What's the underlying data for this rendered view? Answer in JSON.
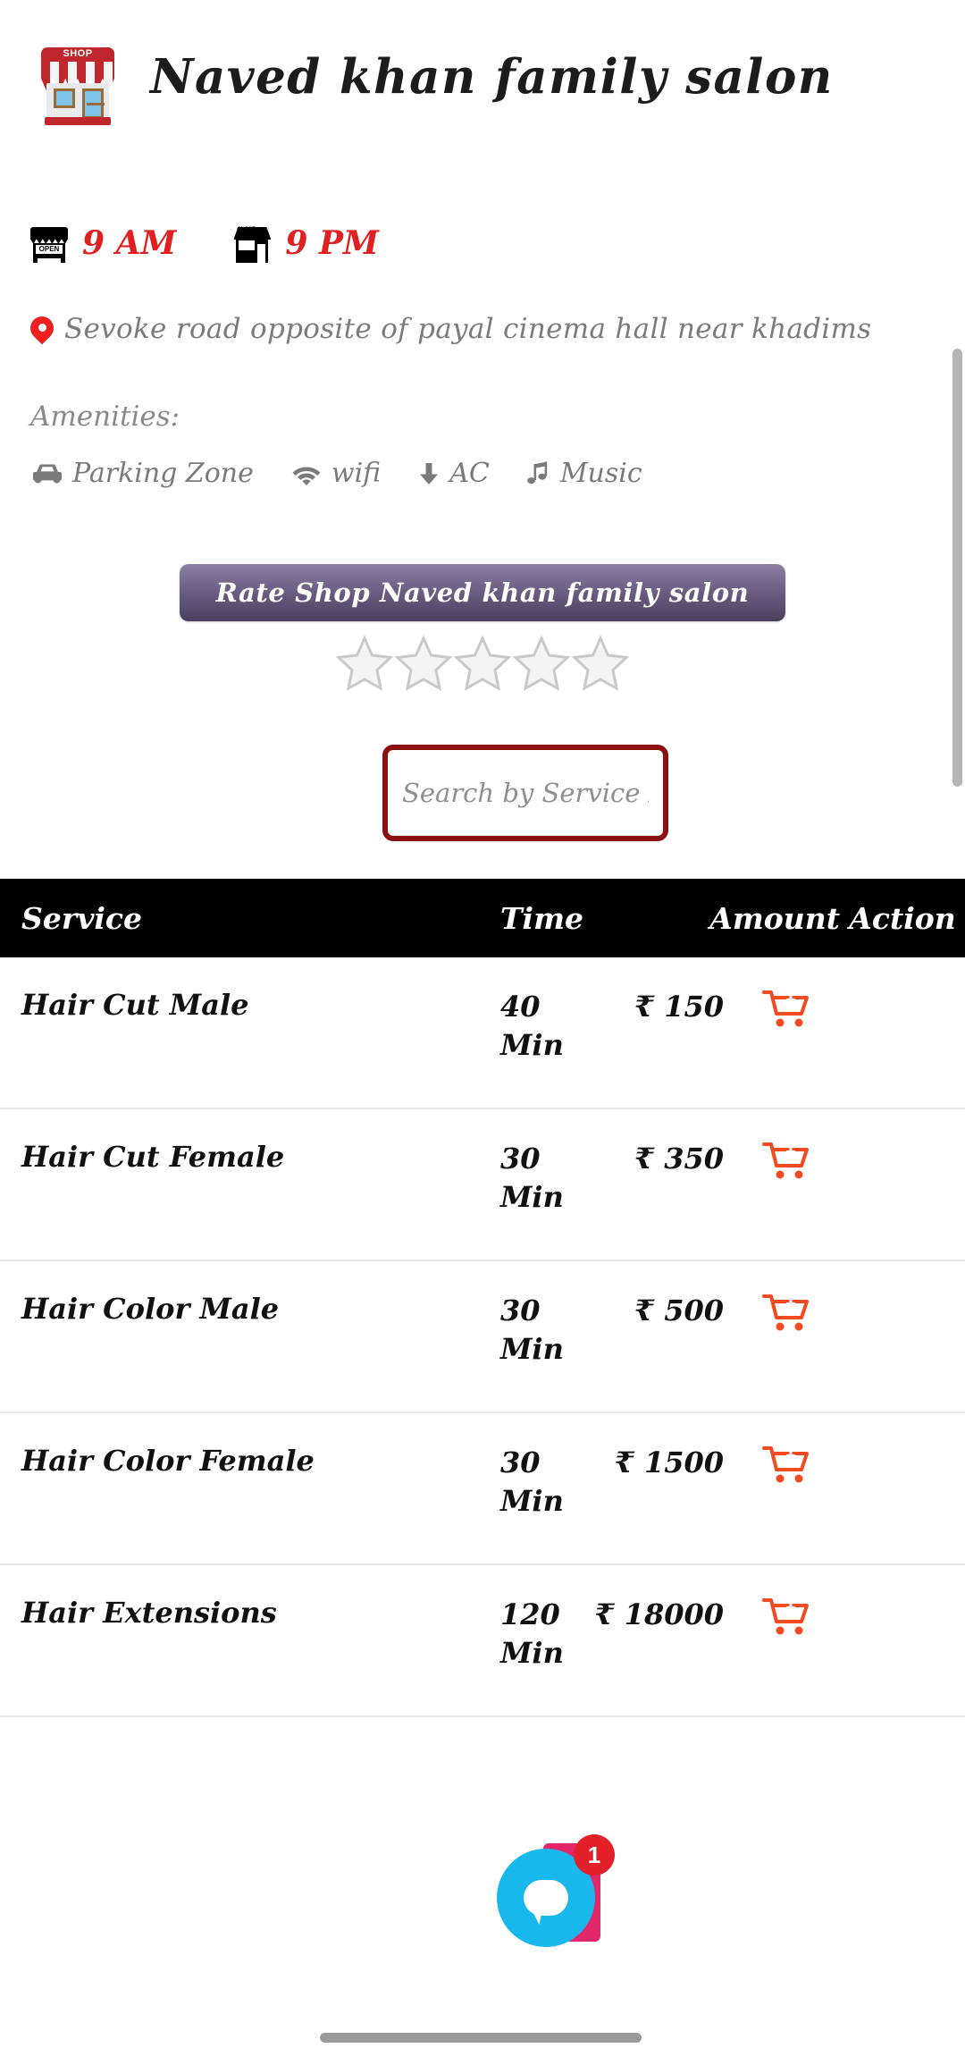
{
  "shop": {
    "title": "Naved khan family salon",
    "logo_icon": "shop-storefront-icon",
    "open_time": "9 AM",
    "close_time": "9 PM",
    "open_icon_label": "OPEN",
    "close_icon_label": "CLOSE",
    "address": "Sevoke road opposite of payal cinema hall near khadims",
    "address_icon": "location-pin-icon"
  },
  "amenities": {
    "label": "Amenities:",
    "items": [
      {
        "label": "Parking Zone",
        "icon": "car-icon"
      },
      {
        "label": "wifi",
        "icon": "wifi-icon"
      },
      {
        "label": "AC",
        "icon": "arrow-down-icon"
      },
      {
        "label": "Music",
        "icon": "music-note-icon"
      }
    ]
  },
  "rating": {
    "button_label": "Rate Shop Naved khan family salon",
    "stars_total": 5,
    "stars_filled": 0
  },
  "search": {
    "placeholder": "Search by Service Name",
    "value": "",
    "border_color": "#8c0f10"
  },
  "services_table": {
    "headers": {
      "service": "Service",
      "time": "Time",
      "amount": "Amount",
      "action": "Action"
    },
    "rows": [
      {
        "service": "Hair Cut Male",
        "time": "40 Min",
        "amount": "₹ 150",
        "action_icon": "add-to-cart-icon"
      },
      {
        "service": "Hair Cut Female",
        "time": "30 Min",
        "amount": "₹ 350",
        "action_icon": "add-to-cart-icon"
      },
      {
        "service": "Hair Color Male",
        "time": "30 Min",
        "amount": "₹ 500",
        "action_icon": "add-to-cart-icon"
      },
      {
        "service": "Hair Color Female",
        "time": "30 Min",
        "amount": "₹ 1500",
        "action_icon": "add-to-cart-icon"
      },
      {
        "service": "Hair Extensions",
        "time": "120 Min",
        "amount": "₹ 18000",
        "action_icon": "add-to-cart-icon"
      }
    ]
  },
  "chat": {
    "icon": "chat-bubble-icon",
    "badge_count": "1",
    "circle_color": "#18b8ec",
    "badge_color": "#e3202a"
  },
  "colors": {
    "hours_red": "#e02020",
    "muted_gray": "#7a7a7a",
    "rate_button_top": "#8c7fa2",
    "rate_button_bottom": "#4b3f5e",
    "cart_orange": "#f24a21",
    "table_header_bg": "#000000"
  }
}
